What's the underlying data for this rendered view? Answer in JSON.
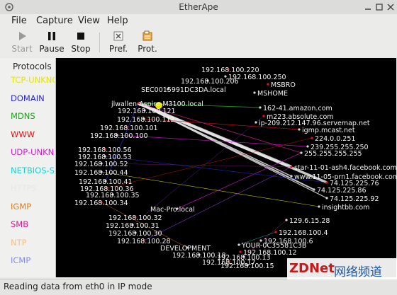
{
  "window": {
    "title": "EtherApe"
  },
  "menu": [
    {
      "label": "File"
    },
    {
      "label": "Capture"
    },
    {
      "label": "View"
    },
    {
      "label": "Help"
    }
  ],
  "toolbar": {
    "start": "Start",
    "pause": "Pause",
    "stop": "Stop",
    "pref": "Pref.",
    "prot": "Prot."
  },
  "legend": {
    "header": "Protocols",
    "items": [
      {
        "label": "TCP-UNKNOWN",
        "color": "#e5e500"
      },
      {
        "label": "DOMAIN",
        "color": "#2a2ad8"
      },
      {
        "label": "MDNS",
        "color": "#1ba51b"
      },
      {
        "label": "WWW",
        "color": "#e01414"
      },
      {
        "label": "UDP-UNKNOWN",
        "color": "#d41ad4"
      },
      {
        "label": "NETBIOS-SSN",
        "color": "#14d4d4"
      },
      {
        "label": "HTTPS",
        "color": "#e8e8e8"
      },
      {
        "label": "IGMP",
        "color": "#e07d1a"
      },
      {
        "label": "SMB",
        "color": "#d0208a"
      },
      {
        "label": "NTP",
        "color": "#f6c08a"
      },
      {
        "label": "ICMP",
        "color": "#8a8ae8"
      }
    ]
  },
  "nodes": [
    {
      "label": "192.168.100.220"
    },
    {
      "label": "192.168.100.250"
    },
    {
      "label": "192.168.100.206"
    },
    {
      "label": "MSBRO"
    },
    {
      "label": "SEC0015991DC3DA.local"
    },
    {
      "label": "MSHOME"
    },
    {
      "label": "jlwallen-Aspire-M3100.local"
    },
    {
      "label": "192.168.100.121"
    },
    {
      "label": "162-41.amazon.com"
    },
    {
      "label": "m223.absolute.com"
    },
    {
      "label": "192.168.100.112"
    },
    {
      "label": "ip-209.212.147.96.servemap.net"
    },
    {
      "label": "192.168.100.101"
    },
    {
      "label": "igmp.mcast.net"
    },
    {
      "label": "192.168.100.100"
    },
    {
      "label": "224.0.0.251"
    },
    {
      "label": "239.255.255.250"
    },
    {
      "label": "255.255.255.255"
    },
    {
      "label": "192.168.100.56"
    },
    {
      "label": "192.168.100.53"
    },
    {
      "label": "192.168.100.52"
    },
    {
      "label": "star-11-01-ash4.facebook.com"
    },
    {
      "label": "192.168.100.44"
    },
    {
      "label": "www.11-05-prn1.facebook.com"
    },
    {
      "label": "74.125.225.76"
    },
    {
      "label": "192.168.100.41"
    },
    {
      "label": "74.125.225.86"
    },
    {
      "label": "192.168.100.36"
    },
    {
      "label": "192.168.100.35"
    },
    {
      "label": "74.125.225.92"
    },
    {
      "label": "192.168.100.34"
    },
    {
      "label": "insightbb.com"
    },
    {
      "label": "Mac-Pro.local"
    },
    {
      "label": "192.168.100.32"
    },
    {
      "label": "129.6.15.28"
    },
    {
      "label": "192.168.100.31"
    },
    {
      "label": "192.168.100.4"
    },
    {
      "label": "192.168.100.30"
    },
    {
      "label": "192.168.100.6"
    },
    {
      "label": "192.168.100.28"
    },
    {
      "label": "YOUR-0C35581C3B"
    },
    {
      "label": "DEVELOPMENT"
    },
    {
      "label": "192.168.100.12"
    },
    {
      "label": "192.168.100.18"
    },
    {
      "label": "192.168.100.13"
    },
    {
      "label": "192.168.100.17"
    },
    {
      "label": "192.168.100.15"
    }
  ],
  "status": {
    "text": "Reading data from eth0 in IP mode"
  },
  "watermark": {
    "brand": "ZDNet",
    "cn": "网络频道"
  }
}
